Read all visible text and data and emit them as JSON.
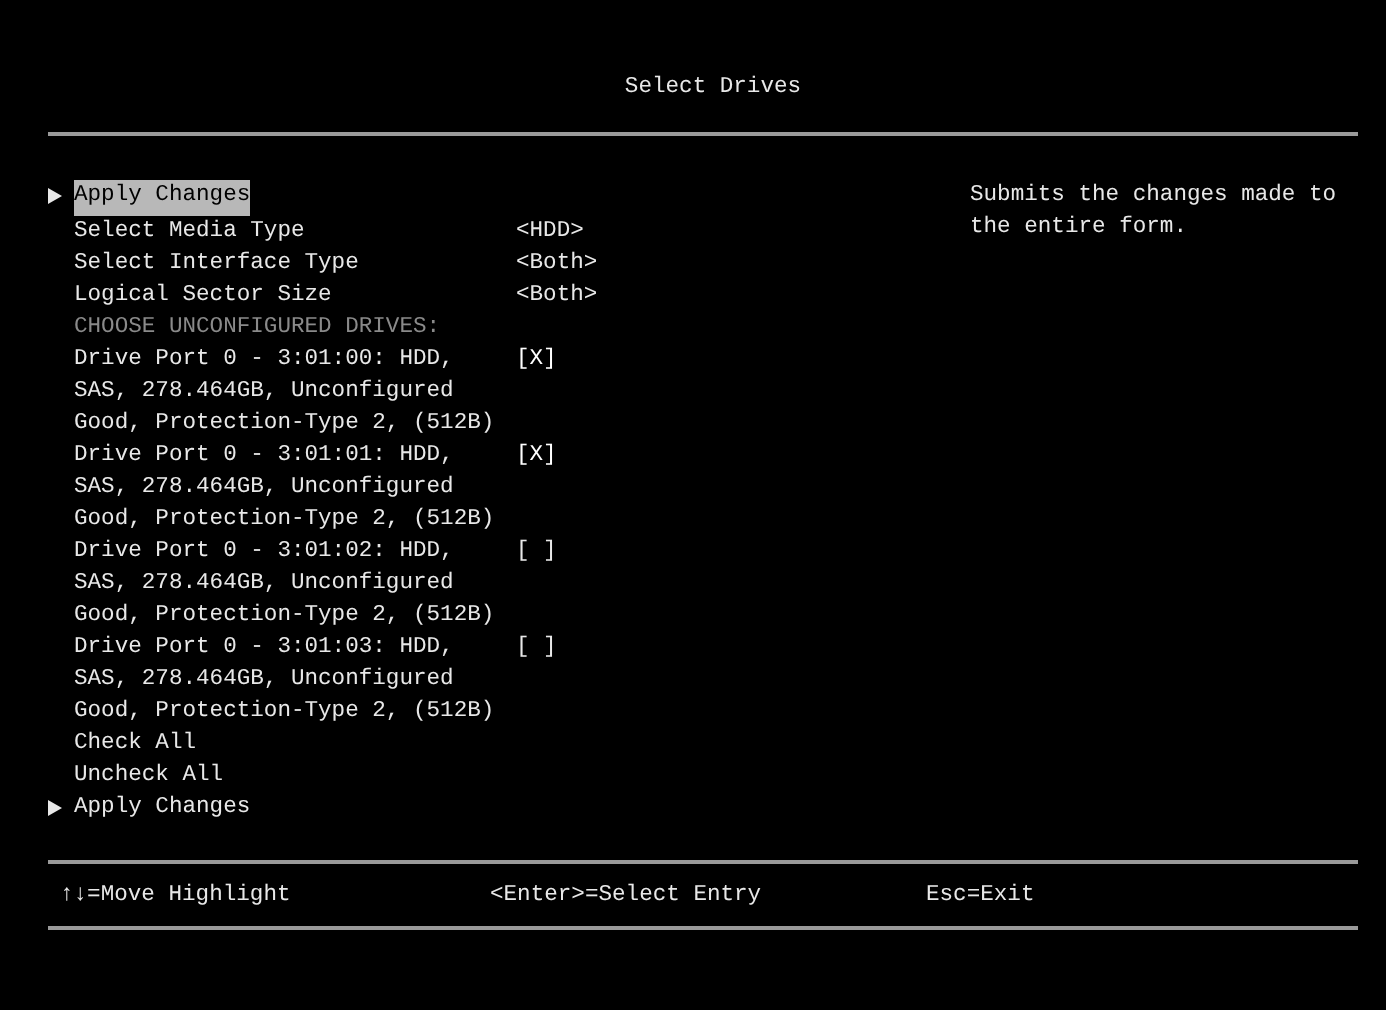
{
  "title": "Select Drives",
  "items": [
    {
      "kind": "submenu",
      "label": "Apply Changes",
      "selected": true
    },
    {
      "kind": "option",
      "label": "Select Media Type",
      "value": "<HDD>",
      "selected": false
    },
    {
      "kind": "option",
      "label": "Select Interface Type",
      "value": "<Both>",
      "selected": false
    },
    {
      "kind": "option",
      "label": "Logical Sector Size",
      "value": "<Both>",
      "selected": false
    },
    {
      "kind": "heading",
      "label": "CHOOSE UNCONFIGURED DRIVES:"
    },
    {
      "kind": "drive",
      "label": "Drive Port 0 - 3:01:00: HDD, SAS, 278.464GB, Unconfigured Good, Protection-Type 2, (512B)",
      "checkbox": "[X]",
      "checked": true,
      "selected": false
    },
    {
      "kind": "drive",
      "label": "Drive Port 0 - 3:01:01: HDD, SAS, 278.464GB, Unconfigured Good, Protection-Type 2, (512B)",
      "checkbox": "[X]",
      "checked": true,
      "selected": false
    },
    {
      "kind": "drive",
      "label": "Drive Port 0 - 3:01:02: HDD, SAS, 278.464GB, Unconfigured Good, Protection-Type 2, (512B)",
      "checkbox": "[ ]",
      "checked": false,
      "selected": false
    },
    {
      "kind": "drive",
      "label": "Drive Port 0 - 3:01:03: HDD, SAS, 278.464GB, Unconfigured Good, Protection-Type 2, (512B)",
      "checkbox": "[ ]",
      "checked": false,
      "selected": false
    },
    {
      "kind": "action",
      "label": "Check All",
      "selected": false
    },
    {
      "kind": "action",
      "label": "Uncheck All",
      "selected": false
    },
    {
      "kind": "submenu",
      "label": "Apply Changes",
      "selected": false
    }
  ],
  "help": "Submits the changes made to the entire form.",
  "footer": [
    "↑↓=Move Highlight",
    "<Enter>=Select Entry",
    "Esc=Exit"
  ]
}
